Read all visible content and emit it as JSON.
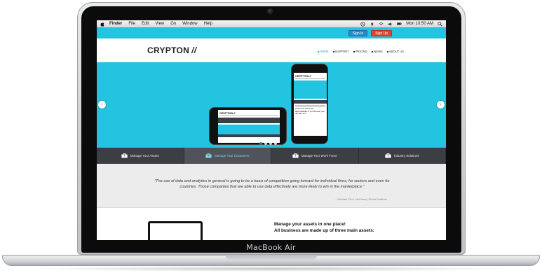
{
  "laptop": {
    "brand": "MacBook Air"
  },
  "menubar": {
    "app": "Finder",
    "items": [
      "File",
      "Edit",
      "View",
      "Go",
      "Window",
      "Help"
    ],
    "clock": "Mon 10:50 AM",
    "icons": [
      "apple-icon",
      "clock-icon",
      "bluetooth-icon",
      "wifi-icon",
      "volume-icon",
      "battery-icon",
      "search-icon"
    ]
  },
  "topbar": {
    "signin": "Sign In",
    "signup": "Sign Up",
    "color": "#22c4df"
  },
  "header": {
    "logo": "CRYPTON",
    "logo_mark": "//",
    "nav": [
      "HOME",
      "SUPPORT",
      "PRICING",
      "NEWS",
      "ABOUT US"
    ],
    "active_nav": "HOME"
  },
  "hero": {
    "prev_arrow": "‹",
    "next_arrow": "›",
    "slides": 4,
    "active_slide": 1,
    "phone_logo": "CRYPTON //",
    "phone_text": "profit now which all automatically if you donate your domain sel..."
  },
  "features": [
    {
      "label": "Manage Your Assets",
      "icon": "briefcase-icon"
    },
    {
      "label": "Manage Your Customers",
      "icon": "briefcase-icon",
      "active": true
    },
    {
      "label": "Manage Your Work Force",
      "icon": "briefcase-icon"
    },
    {
      "label": "Industry Solutions",
      "icon": "briefcase-icon"
    }
  ],
  "quote": {
    "text": "\"The use of data and analytics in general is going to be a basis of competition going forward for individual firms, for sectors and even for countries. Those companies that are able to use data effectively are more likely to win in the marketplace.\"",
    "attribution": "– Michael Chui, McKinsey Global Institute"
  },
  "content": {
    "line1": "Manage your assets in one place!",
    "line2": "All business are made up of three main assets:"
  }
}
